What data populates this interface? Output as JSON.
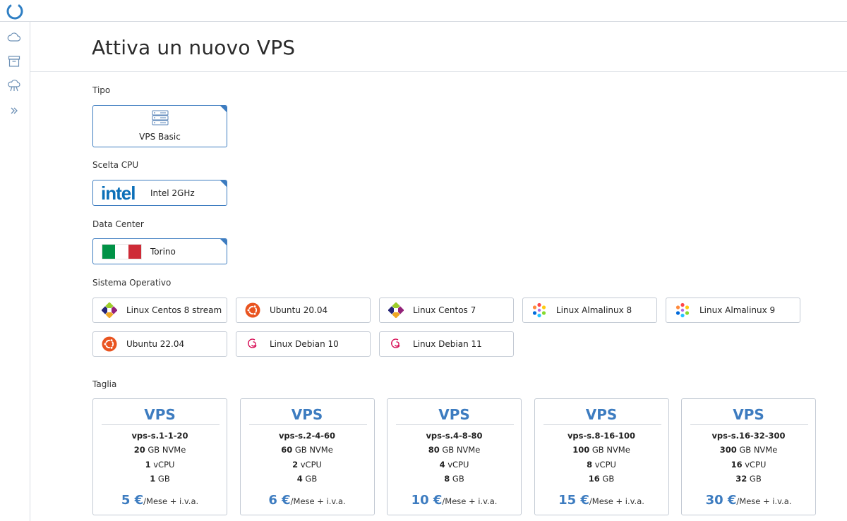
{
  "page": {
    "title": "Attiva un nuovo VPS"
  },
  "colors": {
    "accent": "#3d7cc0",
    "border": "#c3cad4"
  },
  "sidebar": {
    "items": [
      {
        "icon": "cloud-icon"
      },
      {
        "icon": "archive-box-icon"
      },
      {
        "icon": "cloud-network-icon"
      },
      {
        "icon": "double-chevron-right-icon"
      }
    ]
  },
  "tipo": {
    "label": "Tipo",
    "option": "VPS Basic"
  },
  "cpu": {
    "label": "Scelta CPU",
    "logo": "intel",
    "option": "Intel 2GHz"
  },
  "datacenter": {
    "label": "Data Center",
    "option": "Torino",
    "flag_colors": [
      "#009246",
      "#ffffff",
      "#ce2b37"
    ]
  },
  "os": {
    "label": "Sistema Operativo",
    "options": [
      {
        "label": "Linux Centos 8 stream",
        "icon": "centos-icon"
      },
      {
        "label": "Ubuntu 20.04",
        "icon": "ubuntu-icon"
      },
      {
        "label": "Linux Centos 7",
        "icon": "centos-icon"
      },
      {
        "label": "Linux Almalinux 8",
        "icon": "almalinux-icon"
      },
      {
        "label": "Linux Almalinux 9",
        "icon": "almalinux-icon"
      },
      {
        "label": "Ubuntu 22.04",
        "icon": "ubuntu-icon"
      },
      {
        "label": "Linux Debian 10",
        "icon": "debian-icon"
      },
      {
        "label": "Linux Debian 11",
        "icon": "debian-icon"
      }
    ]
  },
  "taglia": {
    "label": "Taglia",
    "plans": [
      {
        "title": "VPS",
        "name": "vps-s.1-1-20",
        "disk_num": "20",
        "disk_unit": "GB NVMe",
        "cpu_num": "1",
        "cpu_unit": "vCPU",
        "ram_num": "1",
        "ram_unit": "GB",
        "price": "5 €",
        "price_suffix": "/Mese + i.v.a."
      },
      {
        "title": "VPS",
        "name": "vps-s.2-4-60",
        "disk_num": "60",
        "disk_unit": "GB NVMe",
        "cpu_num": "2",
        "cpu_unit": "vCPU",
        "ram_num": "4",
        "ram_unit": "GB",
        "price": "6 €",
        "price_suffix": "/Mese + i.v.a."
      },
      {
        "title": "VPS",
        "name": "vps-s.4-8-80",
        "disk_num": "80",
        "disk_unit": "GB NVMe",
        "cpu_num": "4",
        "cpu_unit": "vCPU",
        "ram_num": "8",
        "ram_unit": "GB",
        "price": "10 €",
        "price_suffix": "/Mese + i.v.a."
      },
      {
        "title": "VPS",
        "name": "vps-s.8-16-100",
        "disk_num": "100",
        "disk_unit": "GB NVMe",
        "cpu_num": "8",
        "cpu_unit": "vCPU",
        "ram_num": "16",
        "ram_unit": "GB",
        "price": "15 €",
        "price_suffix": "/Mese + i.v.a."
      },
      {
        "title": "VPS",
        "name": "vps-s.16-32-300",
        "disk_num": "300",
        "disk_unit": "GB NVMe",
        "cpu_num": "16",
        "cpu_unit": "vCPU",
        "ram_num": "32",
        "ram_unit": "GB",
        "price": "30 €",
        "price_suffix": "/Mese + i.v.a."
      }
    ]
  }
}
